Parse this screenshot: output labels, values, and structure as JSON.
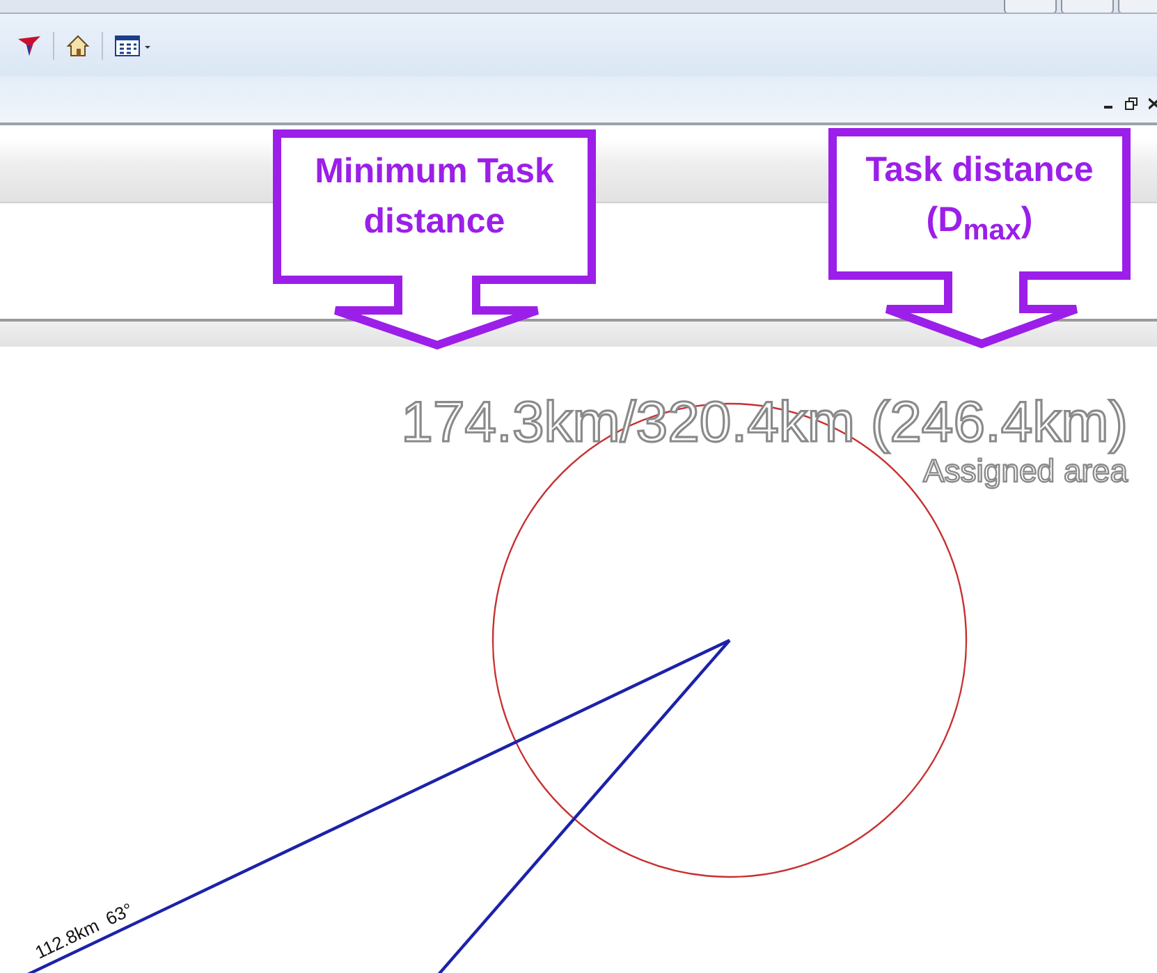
{
  "callouts": [
    {
      "text": "Minimum Task distance"
    },
    {
      "text": "Task distance (D$_{max}$)"
    }
  ],
  "map": {
    "distance_summary": "174.3km/320.4km (246.4km)",
    "zone_label": "Assigned area",
    "leg_label": "112.8km  63°"
  }
}
